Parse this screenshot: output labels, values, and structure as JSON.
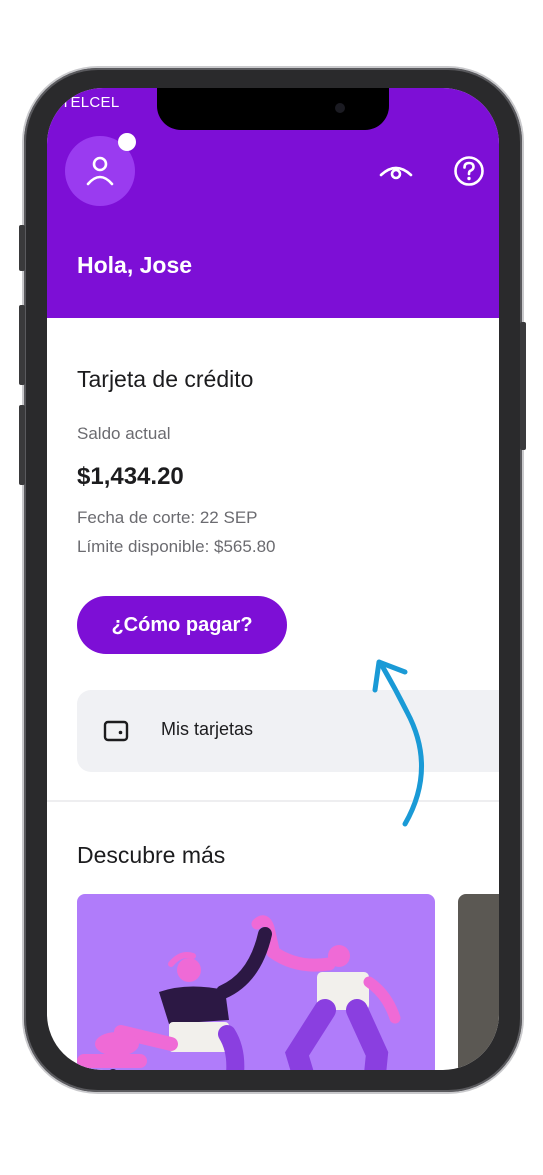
{
  "status_bar": {
    "carrier": "TELCEL"
  },
  "header": {
    "greeting": "Hola, Jose"
  },
  "credit_card": {
    "title": "Tarjeta de crédito",
    "balance_label": "Saldo actual",
    "balance": "$1,434.20",
    "cut_date": "Fecha de corte: 22 SEP",
    "available_limit": "Límite disponible: $565.80",
    "pay_button": "¿Cómo pagar?"
  },
  "my_cards": {
    "label": "Mis tarjetas"
  },
  "discover": {
    "title": "Descubre más"
  },
  "colors": {
    "brand_purple": "#7d0fd6",
    "annotation_arrow": "#1a9ad6"
  },
  "icons": [
    "user-icon",
    "eye-icon",
    "help-icon",
    "card-icon"
  ]
}
